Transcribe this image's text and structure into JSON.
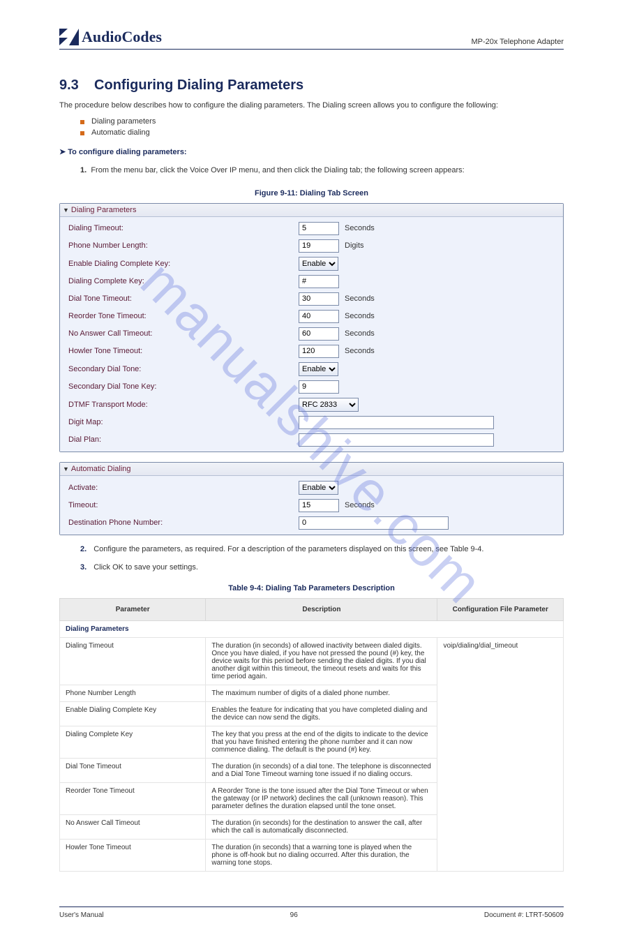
{
  "header": {
    "logo_text": "AudioCodes",
    "right": "MP-20x Telephone Adapter"
  },
  "section": {
    "number": "9.3",
    "title": "Configuring Dialing Parameters",
    "intro": "The procedure below describes how to configure the dialing parameters. The Dialing screen allows you to configure the following:",
    "bullets": [
      "Dialing parameters",
      "Automatic dialing"
    ],
    "howto_lead": "➤  To configure dialing parameters:",
    "nav_step_num": "1.",
    "nav_step": "From the menu bar, click the Voice Over IP menu, and then click the Dialing tab; the following screen appears:"
  },
  "figure_caption": "Figure 9-11: Dialing Tab Screen",
  "panel1": {
    "title": "Dialing Parameters",
    "rows": [
      {
        "label": "Dialing Timeout:",
        "type": "text_short",
        "value": "5",
        "unit": "Seconds",
        "key": "dialing_timeout"
      },
      {
        "label": "Phone Number Length:",
        "type": "text_short",
        "value": "19",
        "unit": "Digits",
        "key": "phone_number_length"
      },
      {
        "label": "Enable Dialing Complete Key:",
        "type": "select",
        "value": "Enable",
        "key": "enable_dialing_complete_key"
      },
      {
        "label": "Dialing Complete Key:",
        "type": "text_short",
        "value": "#",
        "unit": "",
        "key": "dialing_complete_key"
      },
      {
        "label": "Dial Tone Timeout:",
        "type": "text_short",
        "value": "30",
        "unit": "Seconds",
        "key": "dial_tone_timeout"
      },
      {
        "label": "Reorder Tone Timeout:",
        "type": "text_short",
        "value": "40",
        "unit": "Seconds",
        "key": "reorder_tone_timeout"
      },
      {
        "label": "No Answer Call Timeout:",
        "type": "text_short",
        "value": "60",
        "unit": "Seconds",
        "key": "no_answer_call_timeout"
      },
      {
        "label": "Howler Tone Timeout:",
        "type": "text_short",
        "value": "120",
        "unit": "Seconds",
        "key": "howler_tone_timeout"
      },
      {
        "label": "Secondary Dial Tone:",
        "type": "select",
        "value": "Enable",
        "key": "secondary_dial_tone"
      },
      {
        "label": "Secondary Dial Tone Key:",
        "type": "text_short",
        "value": "9",
        "unit": "",
        "key": "secondary_dial_tone_key"
      },
      {
        "label": "DTMF Transport Mode:",
        "type": "select_wide",
        "value": "RFC 2833",
        "key": "dtmf_transport_mode"
      },
      {
        "label": "Digit Map:",
        "type": "text_long",
        "value": "",
        "key": "digit_map"
      },
      {
        "label": "Dial Plan:",
        "type": "text_long",
        "value": "",
        "key": "dial_plan"
      }
    ]
  },
  "panel2": {
    "title": "Automatic Dialing",
    "rows": [
      {
        "label": "Activate:",
        "type": "select",
        "value": "Enable",
        "key": "activate"
      },
      {
        "label": "Timeout:",
        "type": "text_short",
        "value": "15",
        "unit": "Seconds",
        "key": "auto_timeout"
      },
      {
        "label": "Destination Phone Number:",
        "type": "text_mid",
        "value": "0",
        "key": "dest_phone"
      }
    ]
  },
  "step2": {
    "num": "2.",
    "text": "Configure the parameters, as required. For a description of the parameters displayed on this screen, see Table 9-4."
  },
  "step3": {
    "num": "3.",
    "text": "Click OK to save your settings."
  },
  "table_caption": "Table 9-4: Dialing Tab Parameters Description",
  "table": {
    "headers": [
      "Parameter",
      "Description",
      "Configuration File Parameter"
    ],
    "section_head": "Dialing Parameters",
    "rows": [
      {
        "p": "Dialing Timeout",
        "d": "The duration (in seconds) of allowed inactivity between dialed digits. Once you have dialed, if you have not pressed the pound (#) key, the device waits for this period before sending the dialed digits. If you dial another digit within this timeout, the timeout resets and waits for this time period again.",
        "c": "voip/dialing/dial_timeout",
        "rs": 8
      },
      {
        "p": "Phone Number Length",
        "d": "The maximum number of digits of a dialed phone number.",
        "c": ""
      },
      {
        "p": "Enable Dialing Complete Key",
        "d": "Enables the feature for indicating that you have completed dialing and the device can now send the digits.",
        "c": ""
      },
      {
        "p": "Dialing Complete Key",
        "d": "The key that you press at the end of the digits to indicate to the device that you have finished entering the phone number and it can now commence dialing. The default is the pound (#) key.",
        "c": ""
      },
      {
        "p": "Dial Tone Timeout",
        "d": "The duration (in seconds) of a dial tone. The telephone is disconnected and a Dial Tone Timeout warning tone issued if no dialing occurs.",
        "c": ""
      },
      {
        "p": "Reorder Tone Timeout",
        "d": "A Reorder Tone is the tone issued after the Dial Tone Timeout or when the gateway (or IP network) declines the call (unknown reason). This parameter defines the duration elapsed until the tone onset.",
        "c": ""
      },
      {
        "p": "No Answer Call Timeout",
        "d": "The duration (in seconds) for the destination to answer the call, after which the call is automatically disconnected.",
        "c": ""
      },
      {
        "p": "Howler Tone Timeout",
        "d": "The duration (in seconds) that a warning tone is played when the phone is off-hook but no dialing occurred. After this duration, the warning tone stops.",
        "c": ""
      }
    ]
  },
  "footer": {
    "left": "User's Manual",
    "center": "96",
    "right": "Document #: LTRT-50609"
  },
  "watermark": "manualshive.com"
}
